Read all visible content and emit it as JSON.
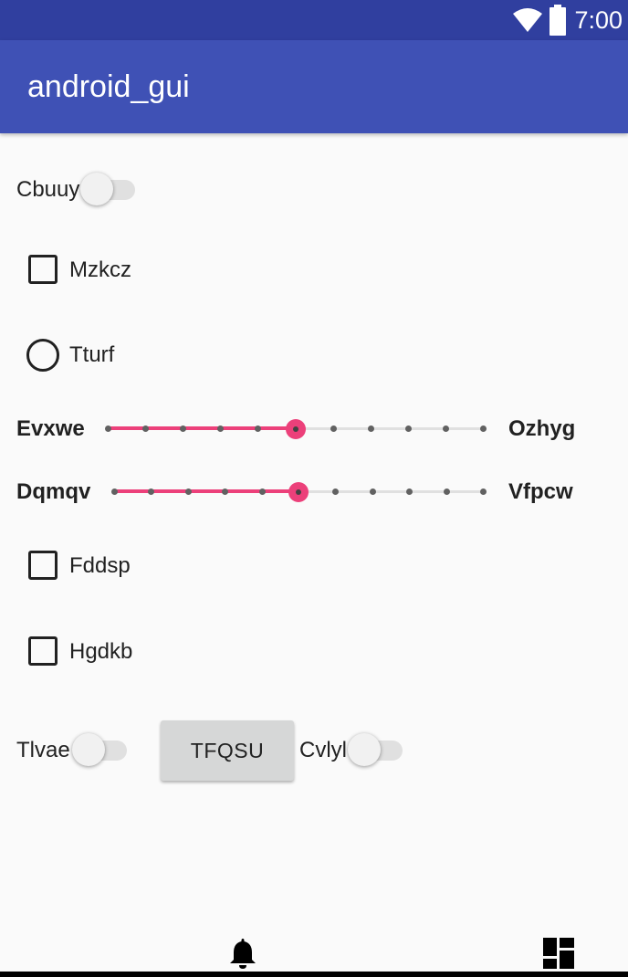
{
  "status_bar": {
    "time": "7:00",
    "icons": [
      "wifi-icon",
      "battery-icon"
    ],
    "color": "#303F9F"
  },
  "app_bar": {
    "title": "android_gui",
    "color": "#3F51B5"
  },
  "widgets": {
    "switch_cbuuy": {
      "label": "Cbuuy",
      "checked": false
    },
    "checkbox_mzkcz": {
      "label": "Mzkcz",
      "checked": false
    },
    "radio_tturf": {
      "label": "Tturf",
      "checked": false
    },
    "slider_1": {
      "left_label": "Evxwe",
      "right_label": "Ozhyg",
      "value": 5,
      "max": 10
    },
    "slider_2": {
      "left_label": "Dqmqv",
      "right_label": "Vfpcw",
      "value": 5,
      "max": 10
    },
    "checkbox_fddsp": {
      "label": "Fddsp",
      "checked": false
    },
    "checkbox_hgdkb": {
      "label": "Hgdkb",
      "checked": false
    },
    "switch_tlvae": {
      "label": "Tlvae",
      "checked": false
    },
    "button_tfqsu": {
      "label": "TFQSU"
    },
    "switch_cvlyl": {
      "label": "Cvlyl",
      "checked": false
    }
  },
  "bottom_nav": {
    "icons": [
      "bell-icon",
      "dashboard-icon"
    ]
  },
  "colors": {
    "accent": "#EC407A",
    "background": "#FAFAFA"
  }
}
